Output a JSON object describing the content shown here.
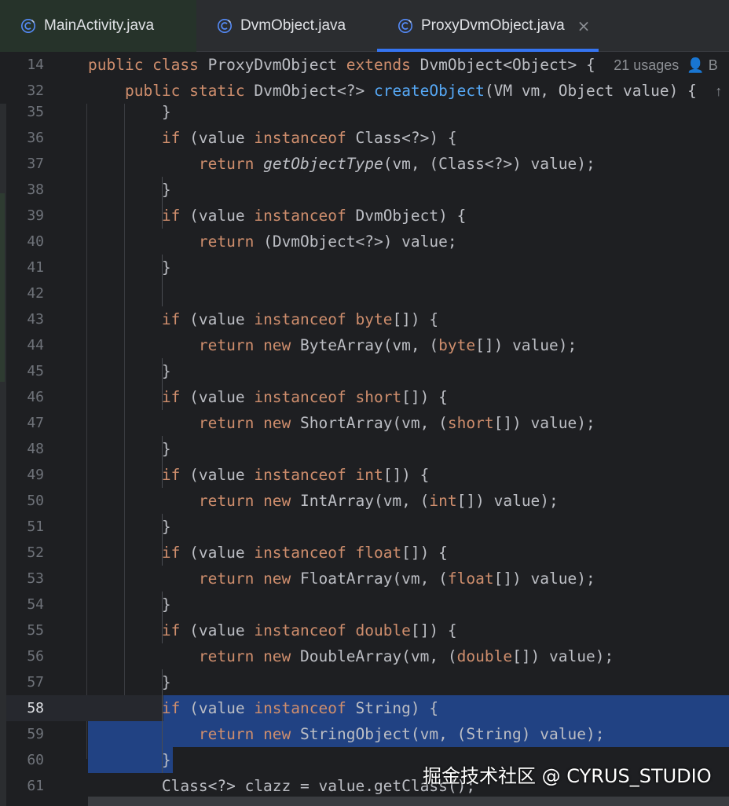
{
  "tabs": [
    {
      "label": "MainActivity.java",
      "icon": "class-c-icon",
      "active": false,
      "closable": false
    },
    {
      "label": "DvmObject.java",
      "icon": "class-c-icon",
      "active": false,
      "closable": false
    },
    {
      "label": "ProxyDvmObject.java",
      "icon": "class-c-icon",
      "active": true,
      "closable": true
    }
  ],
  "close_glyph": "×",
  "sticky": {
    "line1": {
      "num": "14",
      "tokens": [
        {
          "t": "kw",
          "v": "public class "
        },
        {
          "t": "",
          "v": "ProxyDvmObject "
        },
        {
          "t": "kw",
          "v": "extends "
        },
        {
          "t": "",
          "v": "DvmObject<Object> {  "
        },
        {
          "t": "hint",
          "v": "21 usages  "
        },
        {
          "t": "hint",
          "v": "👤 B"
        }
      ]
    },
    "line2": {
      "num": "32",
      "tokens": [
        {
          "t": "",
          "v": "    "
        },
        {
          "t": "kw",
          "v": "public static "
        },
        {
          "t": "",
          "v": "DvmObject<?> "
        },
        {
          "t": "fn",
          "v": "createObject"
        },
        {
          "t": "",
          "v": "(VM vm, Object value) {  "
        },
        {
          "t": "hint",
          "v": "↑"
        }
      ]
    }
  },
  "lines": [
    {
      "num": "35",
      "tokens": [
        {
          "t": "",
          "v": "        }"
        }
      ]
    },
    {
      "num": "36",
      "tokens": [
        {
          "t": "",
          "v": "        "
        },
        {
          "t": "kw",
          "v": "if"
        },
        {
          "t": "",
          "v": " (value "
        },
        {
          "t": "kw",
          "v": "instanceof"
        },
        {
          "t": "",
          "v": " Class<?>) {"
        }
      ]
    },
    {
      "num": "37",
      "tokens": [
        {
          "t": "",
          "v": "            "
        },
        {
          "t": "kw",
          "v": "return "
        },
        {
          "t": "it",
          "v": "getObjectType"
        },
        {
          "t": "",
          "v": "(vm, (Class<?>) value);"
        }
      ]
    },
    {
      "num": "38",
      "tokens": [
        {
          "t": "",
          "v": "        }"
        }
      ]
    },
    {
      "num": "39",
      "tokens": [
        {
          "t": "",
          "v": "        "
        },
        {
          "t": "kw",
          "v": "if"
        },
        {
          "t": "",
          "v": " (value "
        },
        {
          "t": "kw",
          "v": "instanceof"
        },
        {
          "t": "",
          "v": " DvmObject) {"
        }
      ]
    },
    {
      "num": "40",
      "tokens": [
        {
          "t": "",
          "v": "            "
        },
        {
          "t": "kw",
          "v": "return"
        },
        {
          "t": "",
          "v": " (DvmObject<?>) value;"
        }
      ]
    },
    {
      "num": "41",
      "tokens": [
        {
          "t": "",
          "v": "        }"
        }
      ]
    },
    {
      "num": "42",
      "tokens": [
        {
          "t": "",
          "v": ""
        }
      ]
    },
    {
      "num": "43",
      "tokens": [
        {
          "t": "",
          "v": "        "
        },
        {
          "t": "kw",
          "v": "if"
        },
        {
          "t": "",
          "v": " (value "
        },
        {
          "t": "kw",
          "v": "instanceof byte"
        },
        {
          "t": "",
          "v": "[]) {"
        }
      ]
    },
    {
      "num": "44",
      "tokens": [
        {
          "t": "",
          "v": "            "
        },
        {
          "t": "kw",
          "v": "return new "
        },
        {
          "t": "",
          "v": "ByteArray(vm, ("
        },
        {
          "t": "kw",
          "v": "byte"
        },
        {
          "t": "",
          "v": "[]) value);"
        }
      ]
    },
    {
      "num": "45",
      "tokens": [
        {
          "t": "",
          "v": "        }"
        }
      ]
    },
    {
      "num": "46",
      "tokens": [
        {
          "t": "",
          "v": "        "
        },
        {
          "t": "kw",
          "v": "if"
        },
        {
          "t": "",
          "v": " (value "
        },
        {
          "t": "kw",
          "v": "instanceof short"
        },
        {
          "t": "",
          "v": "[]) {"
        }
      ]
    },
    {
      "num": "47",
      "tokens": [
        {
          "t": "",
          "v": "            "
        },
        {
          "t": "kw",
          "v": "return new "
        },
        {
          "t": "",
          "v": "ShortArray(vm, ("
        },
        {
          "t": "kw",
          "v": "short"
        },
        {
          "t": "",
          "v": "[]) value);"
        }
      ]
    },
    {
      "num": "48",
      "tokens": [
        {
          "t": "",
          "v": "        }"
        }
      ]
    },
    {
      "num": "49",
      "tokens": [
        {
          "t": "",
          "v": "        "
        },
        {
          "t": "kw",
          "v": "if"
        },
        {
          "t": "",
          "v": " (value "
        },
        {
          "t": "kw",
          "v": "instanceof int"
        },
        {
          "t": "",
          "v": "[]) {"
        }
      ]
    },
    {
      "num": "50",
      "tokens": [
        {
          "t": "",
          "v": "            "
        },
        {
          "t": "kw",
          "v": "return new "
        },
        {
          "t": "",
          "v": "IntArray(vm, ("
        },
        {
          "t": "kw",
          "v": "int"
        },
        {
          "t": "",
          "v": "[]) value);"
        }
      ]
    },
    {
      "num": "51",
      "tokens": [
        {
          "t": "",
          "v": "        }"
        }
      ]
    },
    {
      "num": "52",
      "tokens": [
        {
          "t": "",
          "v": "        "
        },
        {
          "t": "kw",
          "v": "if"
        },
        {
          "t": "",
          "v": " (value "
        },
        {
          "t": "kw",
          "v": "instanceof float"
        },
        {
          "t": "",
          "v": "[]) {"
        }
      ]
    },
    {
      "num": "53",
      "tokens": [
        {
          "t": "",
          "v": "            "
        },
        {
          "t": "kw",
          "v": "return new "
        },
        {
          "t": "",
          "v": "FloatArray(vm, ("
        },
        {
          "t": "kw",
          "v": "float"
        },
        {
          "t": "",
          "v": "[]) value);"
        }
      ]
    },
    {
      "num": "54",
      "tokens": [
        {
          "t": "",
          "v": "        }"
        }
      ]
    },
    {
      "num": "55",
      "tokens": [
        {
          "t": "",
          "v": "        "
        },
        {
          "t": "kw",
          "v": "if"
        },
        {
          "t": "",
          "v": " (value "
        },
        {
          "t": "kw",
          "v": "instanceof double"
        },
        {
          "t": "",
          "v": "[]) {"
        }
      ]
    },
    {
      "num": "56",
      "tokens": [
        {
          "t": "",
          "v": "            "
        },
        {
          "t": "kw",
          "v": "return new "
        },
        {
          "t": "",
          "v": "DoubleArray(vm, ("
        },
        {
          "t": "kw",
          "v": "double"
        },
        {
          "t": "",
          "v": "[]) value);"
        }
      ]
    },
    {
      "num": "57",
      "tokens": [
        {
          "t": "",
          "v": "        }"
        }
      ]
    },
    {
      "num": "58",
      "current": true,
      "tokens": [
        {
          "t": "",
          "v": "        "
        },
        {
          "t": "kw",
          "v": "if"
        },
        {
          "t": "",
          "v": " (value "
        },
        {
          "t": "kw",
          "v": "instanceof"
        },
        {
          "t": "",
          "v": " String) {"
        }
      ]
    },
    {
      "num": "59",
      "tokens": [
        {
          "t": "",
          "v": "            "
        },
        {
          "t": "kw",
          "v": "return new "
        },
        {
          "t": "",
          "v": "StringObject(vm, (String) value);"
        }
      ]
    },
    {
      "num": "60",
      "tokens": [
        {
          "t": "",
          "v": "        }"
        }
      ]
    },
    {
      "num": "61",
      "tokens": [
        {
          "t": "",
          "v": "        Class<?> clazz = value.getClass();"
        }
      ]
    }
  ],
  "watermark": "掘金技术社区 @ CYRUS_STUDIO",
  "colors": {
    "background": "#1e1f22",
    "keyword": "#cf8e6d",
    "method": "#56a8f5",
    "selection": "#214283",
    "tab_underline": "#3574f0"
  }
}
